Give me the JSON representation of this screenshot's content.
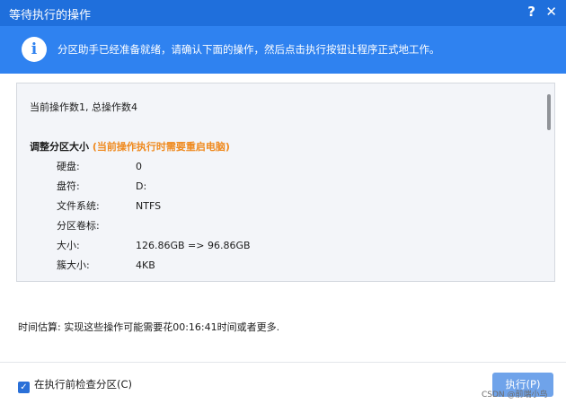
{
  "window": {
    "title": "等待执行的操作",
    "help": "?",
    "close": "✕"
  },
  "banner": {
    "icon": "i",
    "text": "分区助手已经准备就绪，请确认下面的操作，然后点击执行按钮让程序正式地工作。"
  },
  "details": {
    "summary": "当前操作数1, 总操作数4",
    "operation_title": "调整分区大小",
    "operation_note": "(当前操作执行时需要重启电脑)",
    "rows": [
      {
        "key": "硬盘:",
        "value": "0"
      },
      {
        "key": "盘符:",
        "value": "D:"
      },
      {
        "key": "文件系统:",
        "value": "NTFS"
      },
      {
        "key": "分区卷标:",
        "value": ""
      },
      {
        "key": "大小:",
        "value": "126.86GB => 96.86GB"
      },
      {
        "key": "簇大小:",
        "value": "4KB"
      }
    ]
  },
  "estimate": "时间估算: 实现这些操作可能需要花00:16:41时间或者更多.",
  "footer": {
    "check_label": "在执行前检查分区(C)",
    "check_mark": "✓",
    "checked": true,
    "execute_label": "执行(P)"
  },
  "watermark": "CSDN @前端小鸟",
  "colors": {
    "titlebar": "#1f6fdc",
    "banner": "#2f82f0",
    "note": "#ef8a1f",
    "button": "#6fa3ea"
  }
}
